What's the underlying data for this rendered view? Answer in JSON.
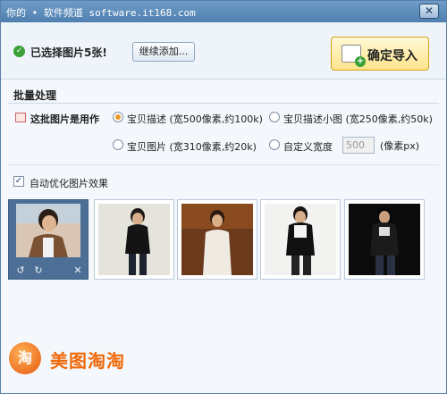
{
  "window": {
    "title": "你的 • 软件频道 software.it168.com",
    "close_glyph": "✕"
  },
  "header": {
    "selected_text": "已选择图片5张!",
    "continue_button": "继续添加...",
    "import_button": "确定导入"
  },
  "batch": {
    "section_title": "批量处理",
    "use_label": "这批图片是用作",
    "options": [
      {
        "label": "宝贝描述 (宽500像素,约100k)",
        "selected": true
      },
      {
        "label": "宝贝描述小图 (宽250像素,约50k)",
        "selected": false
      },
      {
        "label": "宝贝图片 (宽310像素,约20k)",
        "selected": false
      },
      {
        "label": "自定义宽度",
        "selected": false
      }
    ],
    "custom_width_value": "500",
    "custom_width_unit": "(像素px)"
  },
  "optimize": {
    "label": "自动优化图片效果",
    "checked": true
  },
  "thumb_tools": {
    "rotate_left": "↺",
    "rotate_right": "↻",
    "remove": "✕"
  },
  "footer": {
    "logo_mark": "淘",
    "logo_text": "美图淘淘"
  },
  "colors": {
    "accent_orange": "#f06a0a",
    "title_blue": "#4f7fb0",
    "selected_thumb": "#4d6f95",
    "check_green": "#3aa037"
  }
}
